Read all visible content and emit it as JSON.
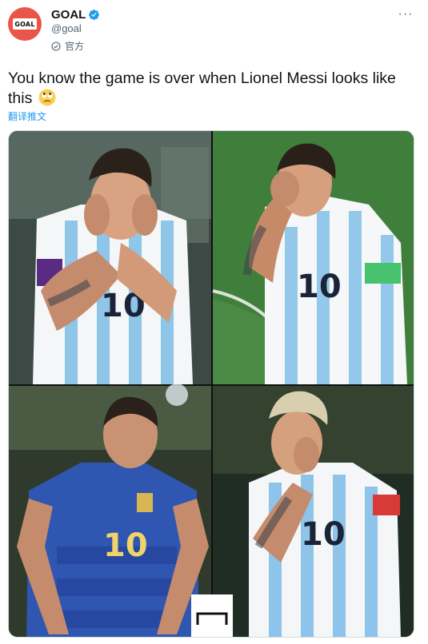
{
  "author": {
    "display_name": "GOAL",
    "handle": "@goal",
    "label": "官方",
    "avatar_logo": "GOAL",
    "verified_icon": "verified-badge-icon"
  },
  "tweet": {
    "text": "You know the game is over when Lionel Messi looks like this",
    "emoji": "face-with-rolling-eyes",
    "translate_label": "翻译推文"
  },
  "media": {
    "panels": [
      {
        "jersey_number": "10",
        "kit": "white-light-blue stripes"
      },
      {
        "jersey_number": "10",
        "kit": "white-light-blue stripes"
      },
      {
        "jersey_number": "10",
        "kit": "dark blue away"
      },
      {
        "jersey_number": "10",
        "kit": "white-light-blue stripes"
      }
    ]
  },
  "colors": {
    "accent": "#1d9bf0",
    "avatar_bg": "#e8564a",
    "secondary_text": "#536471"
  }
}
